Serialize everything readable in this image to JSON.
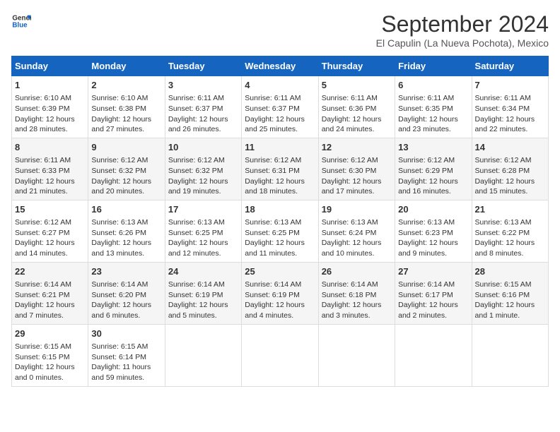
{
  "logo": {
    "line1": "General",
    "line2": "Blue"
  },
  "title": "September 2024",
  "subtitle": "El Capulin (La Nueva Pochota), Mexico",
  "days_of_week": [
    "Sunday",
    "Monday",
    "Tuesday",
    "Wednesday",
    "Thursday",
    "Friday",
    "Saturday"
  ],
  "weeks": [
    [
      {
        "day": "1",
        "info": "Sunrise: 6:10 AM\nSunset: 6:39 PM\nDaylight: 12 hours\nand 28 minutes."
      },
      {
        "day": "2",
        "info": "Sunrise: 6:10 AM\nSunset: 6:38 PM\nDaylight: 12 hours\nand 27 minutes."
      },
      {
        "day": "3",
        "info": "Sunrise: 6:11 AM\nSunset: 6:37 PM\nDaylight: 12 hours\nand 26 minutes."
      },
      {
        "day": "4",
        "info": "Sunrise: 6:11 AM\nSunset: 6:37 PM\nDaylight: 12 hours\nand 25 minutes."
      },
      {
        "day": "5",
        "info": "Sunrise: 6:11 AM\nSunset: 6:36 PM\nDaylight: 12 hours\nand 24 minutes."
      },
      {
        "day": "6",
        "info": "Sunrise: 6:11 AM\nSunset: 6:35 PM\nDaylight: 12 hours\nand 23 minutes."
      },
      {
        "day": "7",
        "info": "Sunrise: 6:11 AM\nSunset: 6:34 PM\nDaylight: 12 hours\nand 22 minutes."
      }
    ],
    [
      {
        "day": "8",
        "info": "Sunrise: 6:11 AM\nSunset: 6:33 PM\nDaylight: 12 hours\nand 21 minutes."
      },
      {
        "day": "9",
        "info": "Sunrise: 6:12 AM\nSunset: 6:32 PM\nDaylight: 12 hours\nand 20 minutes."
      },
      {
        "day": "10",
        "info": "Sunrise: 6:12 AM\nSunset: 6:32 PM\nDaylight: 12 hours\nand 19 minutes."
      },
      {
        "day": "11",
        "info": "Sunrise: 6:12 AM\nSunset: 6:31 PM\nDaylight: 12 hours\nand 18 minutes."
      },
      {
        "day": "12",
        "info": "Sunrise: 6:12 AM\nSunset: 6:30 PM\nDaylight: 12 hours\nand 17 minutes."
      },
      {
        "day": "13",
        "info": "Sunrise: 6:12 AM\nSunset: 6:29 PM\nDaylight: 12 hours\nand 16 minutes."
      },
      {
        "day": "14",
        "info": "Sunrise: 6:12 AM\nSunset: 6:28 PM\nDaylight: 12 hours\nand 15 minutes."
      }
    ],
    [
      {
        "day": "15",
        "info": "Sunrise: 6:12 AM\nSunset: 6:27 PM\nDaylight: 12 hours\nand 14 minutes."
      },
      {
        "day": "16",
        "info": "Sunrise: 6:13 AM\nSunset: 6:26 PM\nDaylight: 12 hours\nand 13 minutes."
      },
      {
        "day": "17",
        "info": "Sunrise: 6:13 AM\nSunset: 6:25 PM\nDaylight: 12 hours\nand 12 minutes."
      },
      {
        "day": "18",
        "info": "Sunrise: 6:13 AM\nSunset: 6:25 PM\nDaylight: 12 hours\nand 11 minutes."
      },
      {
        "day": "19",
        "info": "Sunrise: 6:13 AM\nSunset: 6:24 PM\nDaylight: 12 hours\nand 10 minutes."
      },
      {
        "day": "20",
        "info": "Sunrise: 6:13 AM\nSunset: 6:23 PM\nDaylight: 12 hours\nand 9 minutes."
      },
      {
        "day": "21",
        "info": "Sunrise: 6:13 AM\nSunset: 6:22 PM\nDaylight: 12 hours\nand 8 minutes."
      }
    ],
    [
      {
        "day": "22",
        "info": "Sunrise: 6:14 AM\nSunset: 6:21 PM\nDaylight: 12 hours\nand 7 minutes."
      },
      {
        "day": "23",
        "info": "Sunrise: 6:14 AM\nSunset: 6:20 PM\nDaylight: 12 hours\nand 6 minutes."
      },
      {
        "day": "24",
        "info": "Sunrise: 6:14 AM\nSunset: 6:19 PM\nDaylight: 12 hours\nand 5 minutes."
      },
      {
        "day": "25",
        "info": "Sunrise: 6:14 AM\nSunset: 6:19 PM\nDaylight: 12 hours\nand 4 minutes."
      },
      {
        "day": "26",
        "info": "Sunrise: 6:14 AM\nSunset: 6:18 PM\nDaylight: 12 hours\nand 3 minutes."
      },
      {
        "day": "27",
        "info": "Sunrise: 6:14 AM\nSunset: 6:17 PM\nDaylight: 12 hours\nand 2 minutes."
      },
      {
        "day": "28",
        "info": "Sunrise: 6:15 AM\nSunset: 6:16 PM\nDaylight: 12 hours\nand 1 minute."
      }
    ],
    [
      {
        "day": "29",
        "info": "Sunrise: 6:15 AM\nSunset: 6:15 PM\nDaylight: 12 hours\nand 0 minutes."
      },
      {
        "day": "30",
        "info": "Sunrise: 6:15 AM\nSunset: 6:14 PM\nDaylight: 11 hours\nand 59 minutes."
      },
      null,
      null,
      null,
      null,
      null
    ]
  ]
}
